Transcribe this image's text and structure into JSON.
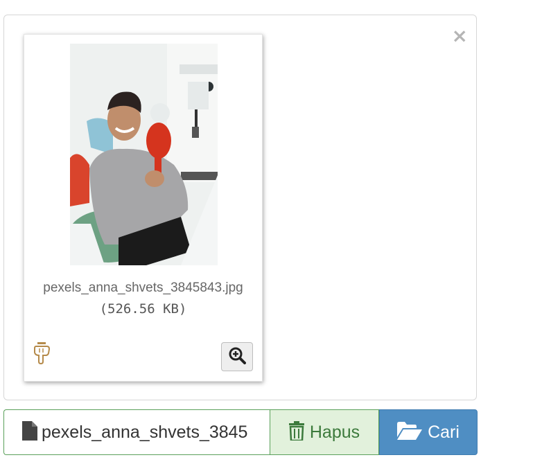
{
  "preview": {
    "close_label": "×",
    "file_name": "pexels_anna_shvets_3845843.jpg",
    "file_size": "(526.56 KB)",
    "drag_icon": "hand-point-down-icon",
    "zoom_icon": "zoom-in-icon"
  },
  "input": {
    "caption": "pexels_anna_shvets_3845",
    "file_icon": "file-icon",
    "remove_label": "Hapus",
    "remove_icon": "trash-icon",
    "browse_label": "Cari",
    "browse_icon": "folder-open-icon"
  },
  "colors": {
    "success_border": "#5aa05a",
    "success_bg": "#e2f1dc",
    "primary": "#4f8ec3",
    "drag_icon": "#b58a4a"
  }
}
